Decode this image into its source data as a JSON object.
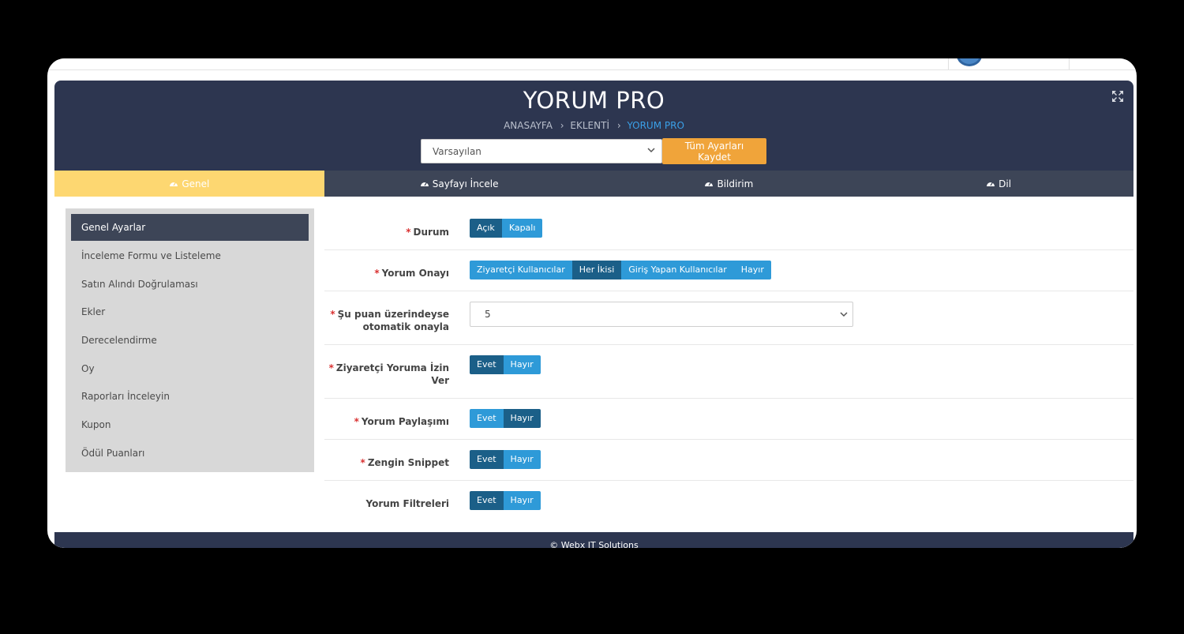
{
  "header": {
    "title": "YORUM PRO",
    "breadcrumb": [
      "ANASAYFA",
      "EKLENTİ",
      "YORUM PRO"
    ],
    "profile_select_value": "Varsayılan",
    "save_all_label": "Tüm Ayarları Kaydet"
  },
  "tabs": [
    {
      "label": "Genel",
      "active": true
    },
    {
      "label": "Sayfayı İncele",
      "active": false
    },
    {
      "label": "Bildirim",
      "active": false
    },
    {
      "label": "Dil",
      "active": false
    }
  ],
  "sidebar": {
    "items": [
      {
        "label": "Genel Ayarlar",
        "active": true
      },
      {
        "label": "İnceleme Formu ve Listeleme"
      },
      {
        "label": "Satın Alındı Doğrulaması"
      },
      {
        "label": "Ekler"
      },
      {
        "label": "Derecelendirme"
      },
      {
        "label": "Oy"
      },
      {
        "label": "Raporları İnceleyin"
      },
      {
        "label": "Kupon"
      },
      {
        "label": "Ödül Puanları"
      }
    ]
  },
  "form": {
    "durum": {
      "label": "Durum",
      "required": "*",
      "options": [
        "Açık",
        "Kapalı"
      ],
      "selected": "Açık"
    },
    "yorum_onayi": {
      "label": "Yorum Onayı",
      "required": "*",
      "options": [
        "Ziyaretçi Kullanıcılar",
        "Her İkisi",
        "Giriş Yapan Kullanıcılar",
        "Hayır"
      ],
      "selected": "Her İkisi"
    },
    "otomatik_onay": {
      "label_line1": "Şu puan üzerindeyse",
      "label_line2": "otomatik onayla",
      "required": "*",
      "value": "5"
    },
    "ziyaretci_izin": {
      "label_line1": "Ziyaretçi Yoruma İzin",
      "label_line2": "Ver",
      "required": "*",
      "options": [
        "Evet",
        "Hayır"
      ],
      "selected": "Evet"
    },
    "yorum_paylasimi": {
      "label": "Yorum Paylaşımı",
      "required": "*",
      "options": [
        "Evet",
        "Hayır"
      ],
      "selected": "Hayır"
    },
    "zengin_snippet": {
      "label": "Zengin Snippet",
      "required": "*",
      "options": [
        "Evet",
        "Hayır"
      ],
      "selected": "Evet"
    },
    "yorum_filtreleri": {
      "label": "Yorum Filtreleri",
      "options": [
        "Evet",
        "Hayır"
      ],
      "selected": "Evet"
    }
  },
  "footer": {
    "text": "© Webx IT Solutions"
  },
  "colors": {
    "header_bg": "#2d3650",
    "tab_bg": "#3d4557",
    "tab_active": "#fdd771",
    "accent_orange": "#f0a43a",
    "btn_blue": "#2e9ad8",
    "btn_selected": "#1b5f88",
    "required": "#d93131"
  },
  "icons": [
    "expand-icon",
    "chevron-down-icon",
    "dashboard-gauge-icon"
  ]
}
